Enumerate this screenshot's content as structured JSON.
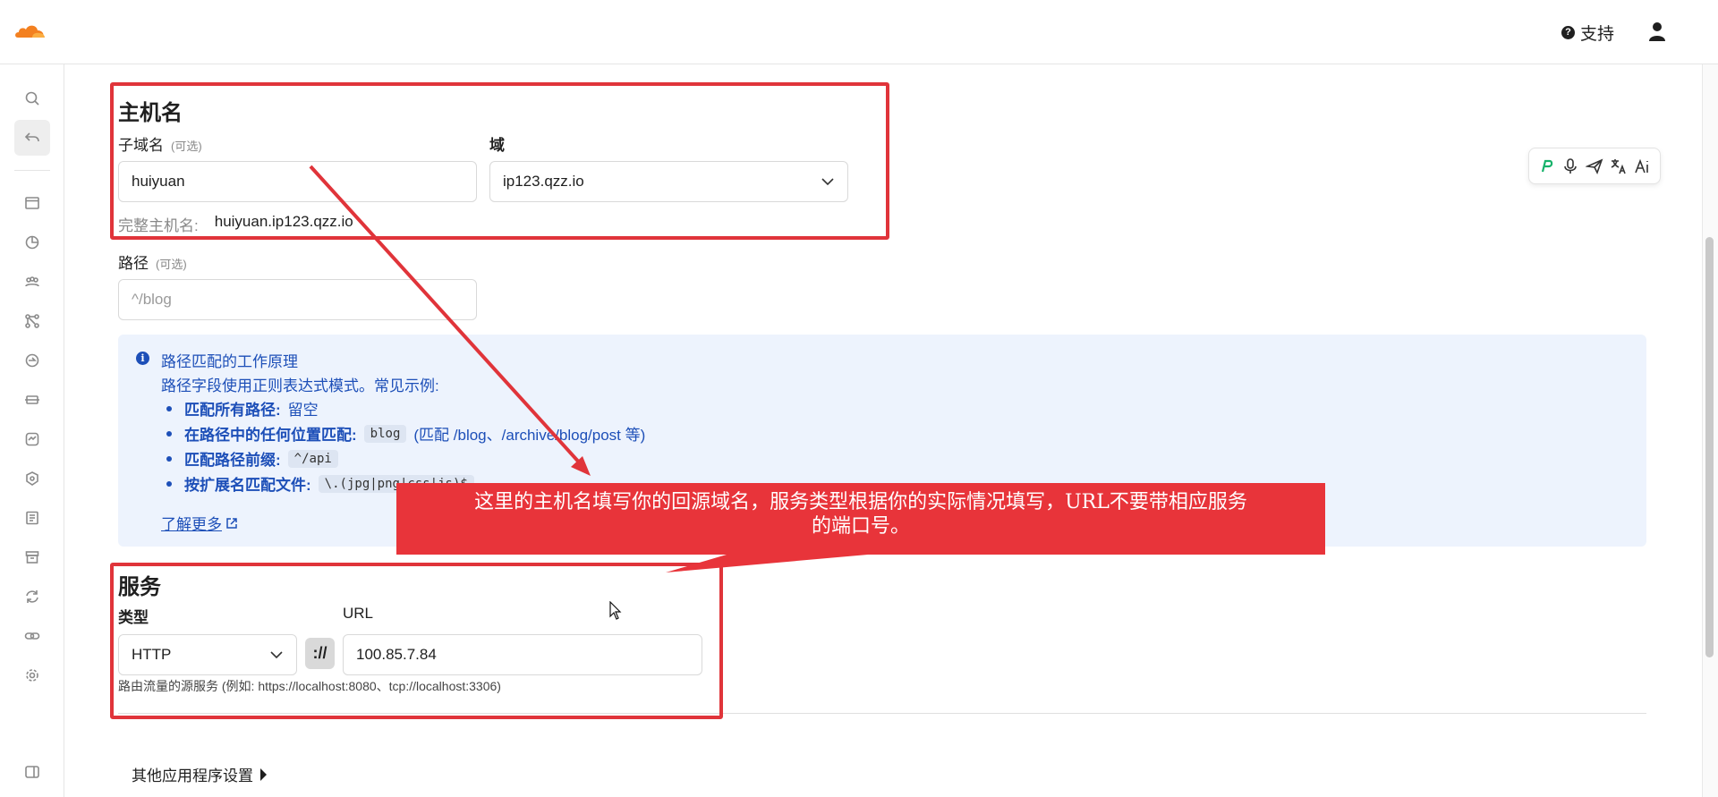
{
  "topbar": {
    "support_label": "支持"
  },
  "hostname": {
    "section_title": "主机名",
    "subdomain_label": "子域名",
    "subdomain_optional": "(可选)",
    "subdomain_value": "huiyuan",
    "domain_label": "域",
    "domain_value": "ip123.qzz.io",
    "full_hostname_label": "完整主机名:",
    "full_hostname_value": "huiyuan.ip123.qzz.io"
  },
  "path": {
    "label": "路径",
    "optional": "(可选)",
    "placeholder": "^/blog"
  },
  "info": {
    "title": "路径匹配的工作原理",
    "description": "路径字段使用正则表达式模式。常见示例:",
    "items": [
      {
        "key": "匹配所有路径:",
        "code": "",
        "text": "留空"
      },
      {
        "key": "在路径中的任何位置匹配:",
        "code": "blog",
        "text": "(匹配 /blog、/archive/blog/post 等)"
      },
      {
        "key": "匹配路径前缀:",
        "code": "^/api",
        "text": ""
      },
      {
        "key": "按扩展名匹配文件:",
        "code": "\\.(jpg|png|css|js)$",
        "text": ""
      }
    ],
    "learn_more": "了解更多"
  },
  "service": {
    "section_title": "服务",
    "type_label": "类型",
    "type_value": "HTTP",
    "protocol_sep": "://",
    "url_label": "URL",
    "url_value": "100.85.7.84",
    "hint": "路由流量的源服务 (例如: https://localhost:8080、tcp://localhost:3306)"
  },
  "more_settings": "其他应用程序设置",
  "annotation": {
    "line1": "这里的主机名填写你的回源域名，服务类型根据你的实际情况填写，URL不要带相应服务",
    "line2": "的端口号。",
    "color": "#e8343a"
  },
  "colors": {
    "brand_orange": "#f38020",
    "info_blue": "#1d4fb8",
    "annotation_red": "#e0343a"
  }
}
